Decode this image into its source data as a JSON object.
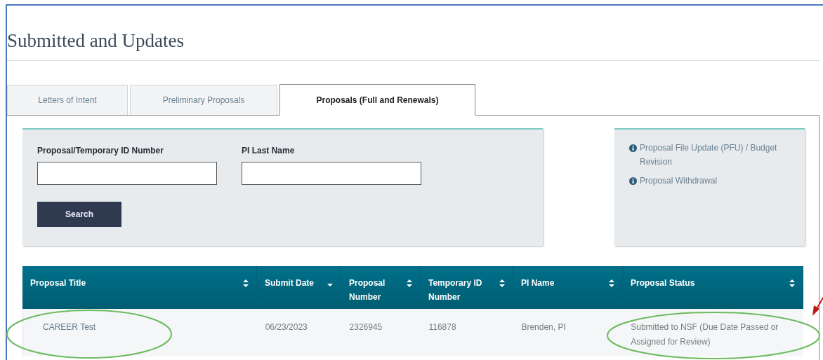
{
  "page": {
    "title": "Submitted and Updates"
  },
  "tabs": [
    {
      "label": "Letters of Intent",
      "selected": false
    },
    {
      "label": "Preliminary Proposals",
      "selected": false
    },
    {
      "label": "Proposals (Full and Renewals)",
      "selected": true
    }
  ],
  "search_form": {
    "fields": [
      {
        "label": "Proposal/Temporary ID Number"
      },
      {
        "label": "PI Last Name"
      }
    ],
    "button": "Search"
  },
  "info_links": [
    {
      "label": "Proposal File Update (PFU) / Budget Revision"
    },
    {
      "label": "Proposal Withdrawal"
    }
  ],
  "table": {
    "columns": [
      {
        "label": "Proposal Title",
        "sorted": false
      },
      {
        "label": "Submit Date",
        "sorted": true
      },
      {
        "label": "Proposal Number",
        "sorted": false
      },
      {
        "label": "Temporary ID Number",
        "sorted": false
      },
      {
        "label": "PI Name",
        "sorted": false
      },
      {
        "label": "Proposal Status",
        "sorted": false
      }
    ],
    "rows": [
      [
        "CAREER Test",
        "06/23/2023",
        "2326945",
        "116878",
        "Brenden, PI",
        "Submitted to NSF (Due Date Passed or Assigned for Review)"
      ]
    ]
  }
}
